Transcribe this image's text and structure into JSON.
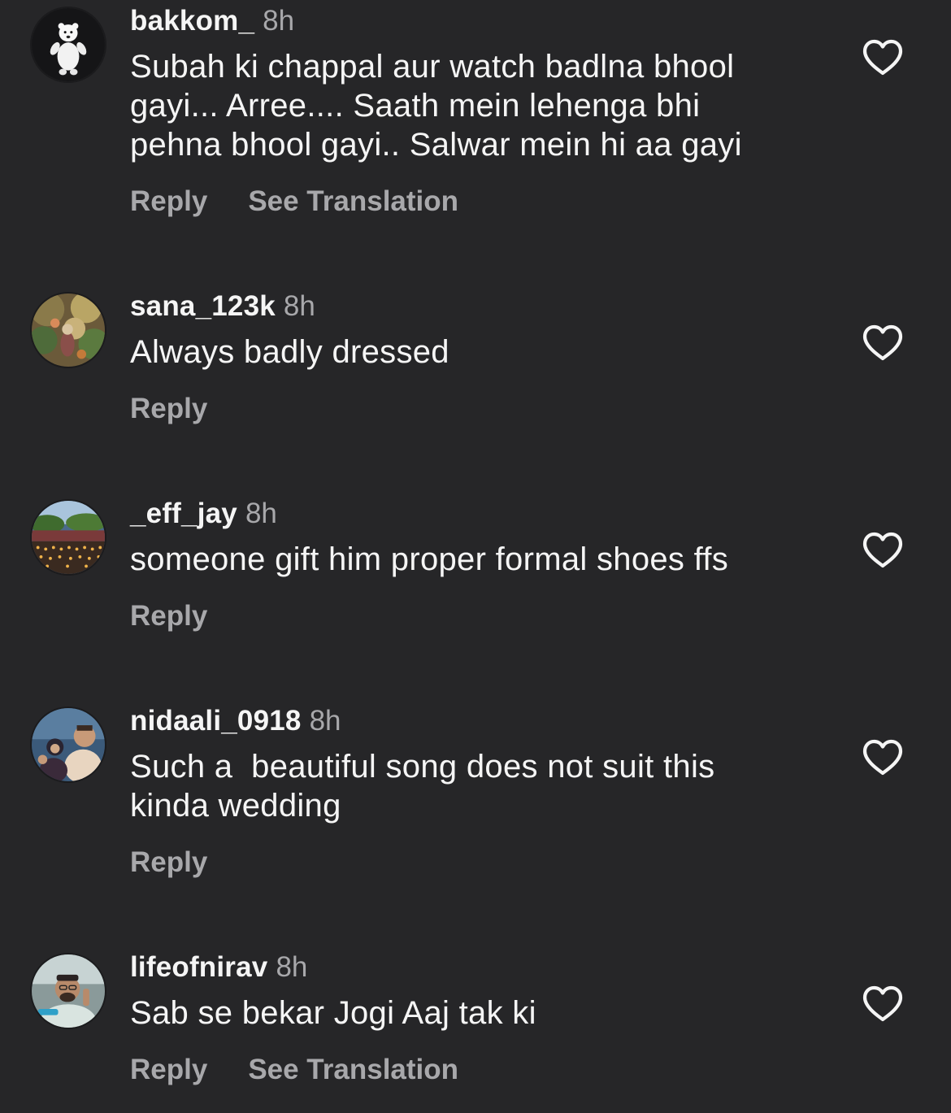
{
  "comments": [
    {
      "username": "bakkom_",
      "time": "8h",
      "text": "Subah ki chappal aur watch badlna bhool\ngayi... Arree.... Saath mein lehenga bhi\npehna bhool gayi.. Salwar mein hi aa gayi",
      "reply_label": "Reply",
      "translation_label": "See Translation",
      "avatar_icon": "polar-bear-avatar",
      "like_icon": "heart-outline-icon"
    },
    {
      "username": "sana_123k",
      "time": "8h",
      "text": "Always badly dressed",
      "reply_label": "Reply",
      "avatar_icon": "garden-photo-avatar",
      "like_icon": "heart-outline-icon"
    },
    {
      "username": "_eff_jay",
      "time": "8h",
      "text": "someone gift him proper formal shoes ffs",
      "reply_label": "Reply",
      "avatar_icon": "venue-lights-avatar",
      "like_icon": "heart-outline-icon"
    },
    {
      "username": "nidaali_0918",
      "time": "8h",
      "text": "Such a  beautiful song does not suit this\nkinda wedding",
      "reply_label": "Reply",
      "avatar_icon": "family-photo-avatar",
      "like_icon": "heart-outline-icon"
    },
    {
      "username": "lifeofnirav",
      "time": "8h",
      "text": "Sab se bekar Jogi Aaj tak ki",
      "reply_label": "Reply",
      "translation_label": "See Translation",
      "avatar_icon": "man-portrait-avatar",
      "like_icon": "heart-outline-icon"
    }
  ],
  "colors": {
    "background": "#262628",
    "primary_text": "#f5f5f5",
    "secondary_text": "#a8a8ab"
  }
}
